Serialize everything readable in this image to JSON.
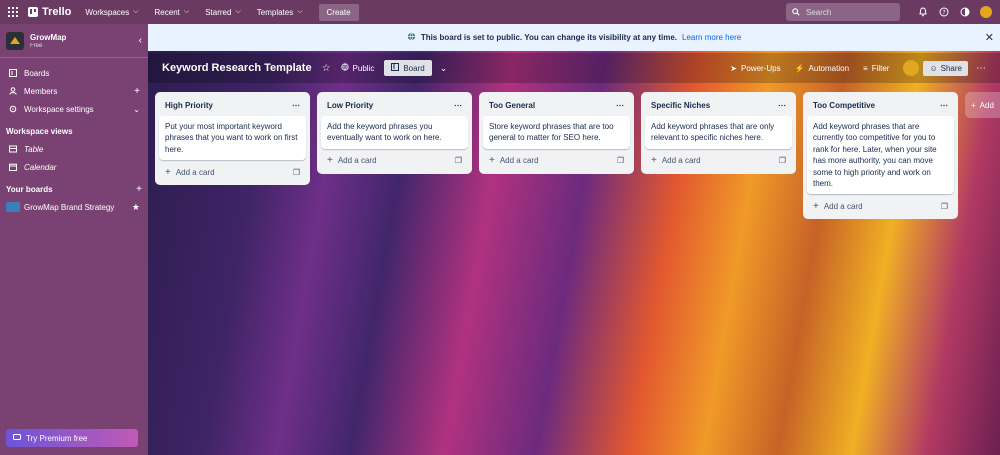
{
  "topnav": {
    "brand": "Trello",
    "menus": [
      "Workspaces",
      "Recent",
      "Starred",
      "Templates"
    ],
    "create_label": "Create",
    "search_placeholder": "Search",
    "icons": [
      "bell-icon",
      "help-icon",
      "theme-icon",
      "account-avatar"
    ]
  },
  "sidebar": {
    "workspace_name": "GrowMap",
    "workspace_plan": "Free",
    "items": [
      {
        "label": "Boards",
        "icon": "boards-icon"
      },
      {
        "label": "Members",
        "icon": "members-icon"
      },
      {
        "label": "Workspace settings",
        "icon": "settings-icon"
      }
    ],
    "views_heading": "Workspace views",
    "views": [
      {
        "label": "Table",
        "icon": "table-icon"
      },
      {
        "label": "Calendar",
        "icon": "calendar-icon"
      }
    ],
    "boards_heading": "Your boards",
    "boards": [
      {
        "label": "GrowMap Brand Strategy",
        "color": "#3a7fb7"
      }
    ],
    "premium_label": "Try Premium free"
  },
  "banner": {
    "message": "This board is set to public. You can change its visibility at any time.",
    "link": "Learn more here"
  },
  "board": {
    "title": "Keyword Research Template",
    "visibility": "Public",
    "view": "Board",
    "power_ups": "Power-Ups",
    "automation": "Automation",
    "filter": "Filter",
    "share": "Share"
  },
  "lists": [
    {
      "title": "High Priority",
      "card": "Put your most important keyword phrases that you want to work on first here.",
      "add": "Add a card"
    },
    {
      "title": "Low Priority",
      "card": "Add the keyword phrases you eventually want to work on here.",
      "add": "Add a card"
    },
    {
      "title": "Too General",
      "card": "Store keyword phrases that are too general to matter for SEO here.",
      "add": "Add a card"
    },
    {
      "title": "Specific Niches",
      "card": "Add keyword phrases that are only relevant to specific niches here.",
      "add": "Add a card"
    },
    {
      "title": "Too Competitive",
      "card": "Add keyword phrases that are currently too competitive for you to rank for here. Later, when your site has more authority, you can move some to high priority and work on them.",
      "add": "Add a card"
    }
  ],
  "add_list_label": "Add"
}
